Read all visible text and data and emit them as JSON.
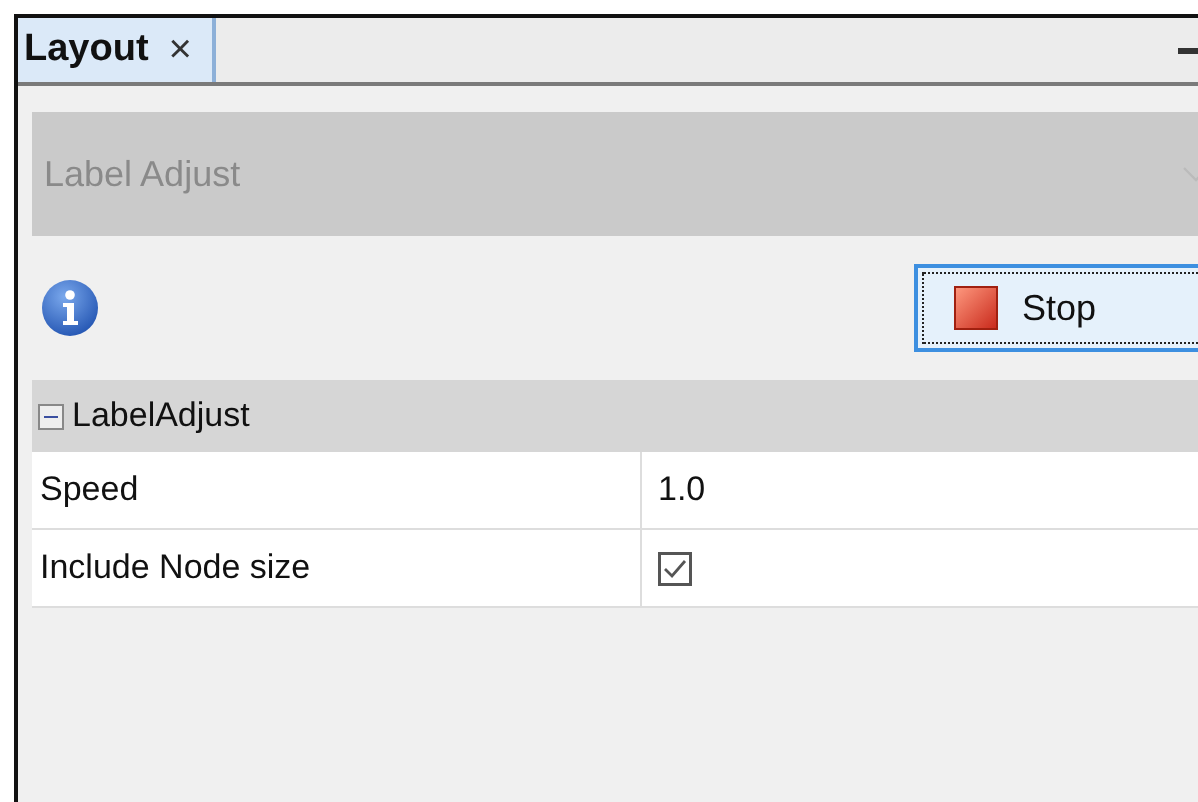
{
  "tabs": [
    {
      "label": "Layout",
      "close": "×",
      "selected": true
    }
  ],
  "layout_selector": {
    "value": "Label Adjust",
    "disabled": true
  },
  "run_button": {
    "label": "Stop"
  },
  "properties": {
    "group": {
      "title": "LabelAdjust",
      "expanded": true
    },
    "rows": [
      {
        "name": "Speed",
        "kind": "text",
        "value": "1.0"
      },
      {
        "name": "Include Node size",
        "kind": "checkbox",
        "checked": true
      }
    ]
  }
}
